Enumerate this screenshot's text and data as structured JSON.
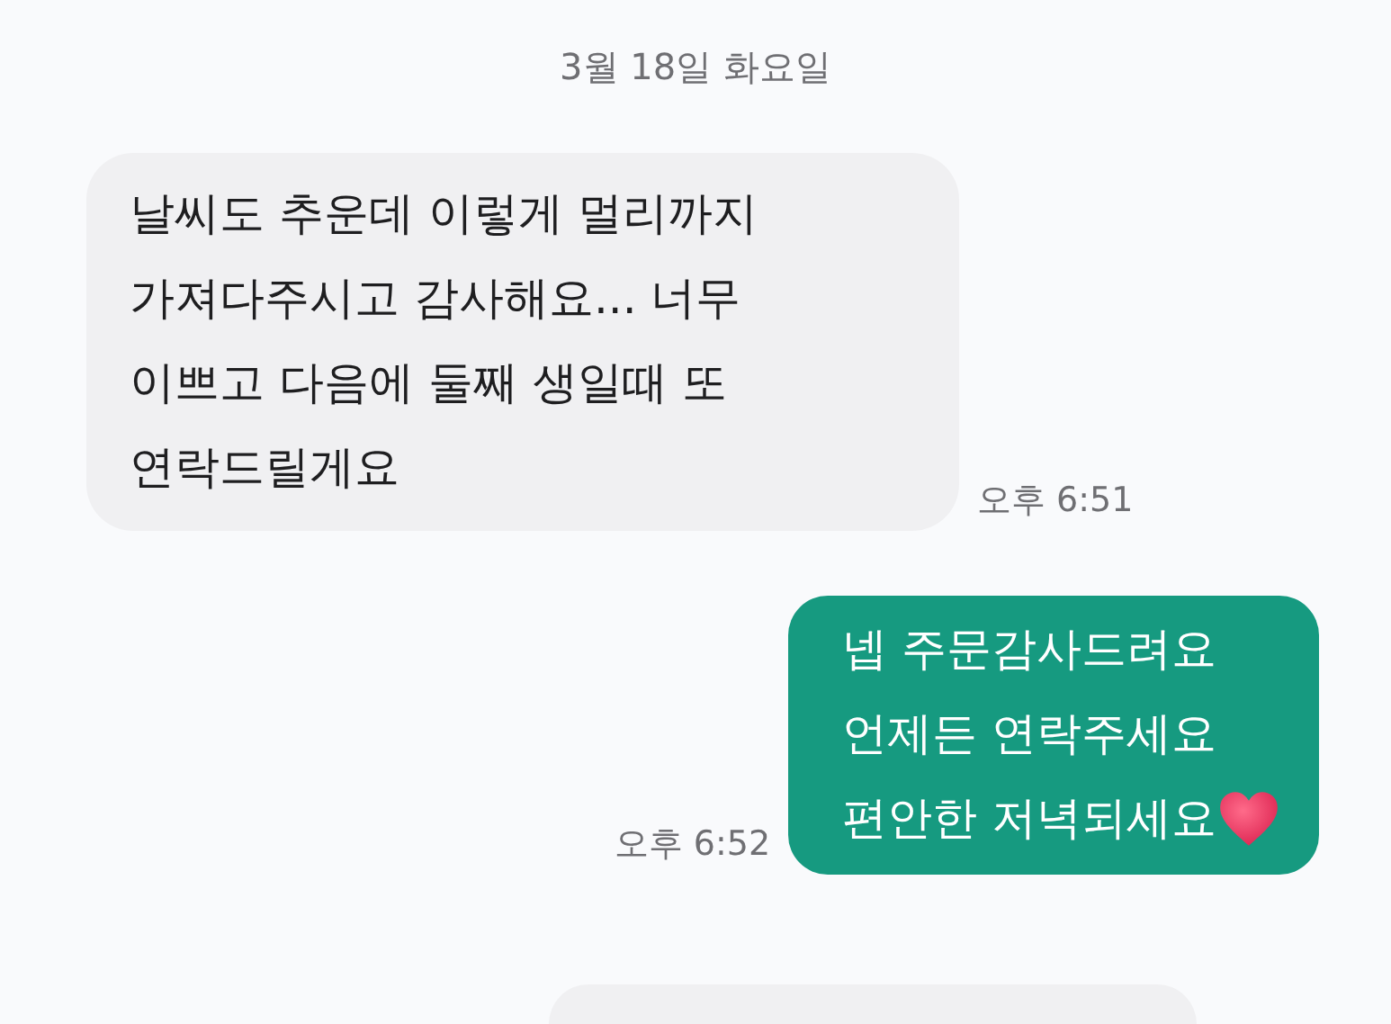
{
  "date_divider": "3월 18일 화요일",
  "messages": [
    {
      "kind": "incoming",
      "lines": [
        "날씨도 추운데 이렇게 멀리까지",
        "가져다주시고 감사해요... 너무",
        "이쁘고 다음에 둘째 생일때 또",
        "연락드릴게요"
      ],
      "time": "오후 6:51",
      "ends_with_heart": false
    },
    {
      "kind": "outgoing",
      "lines": [
        "넵 주문감사드려요",
        "언제든 연락주세요",
        "편안한 저녁되세요"
      ],
      "time": "오후 6:52",
      "ends_with_heart": true
    }
  ]
}
